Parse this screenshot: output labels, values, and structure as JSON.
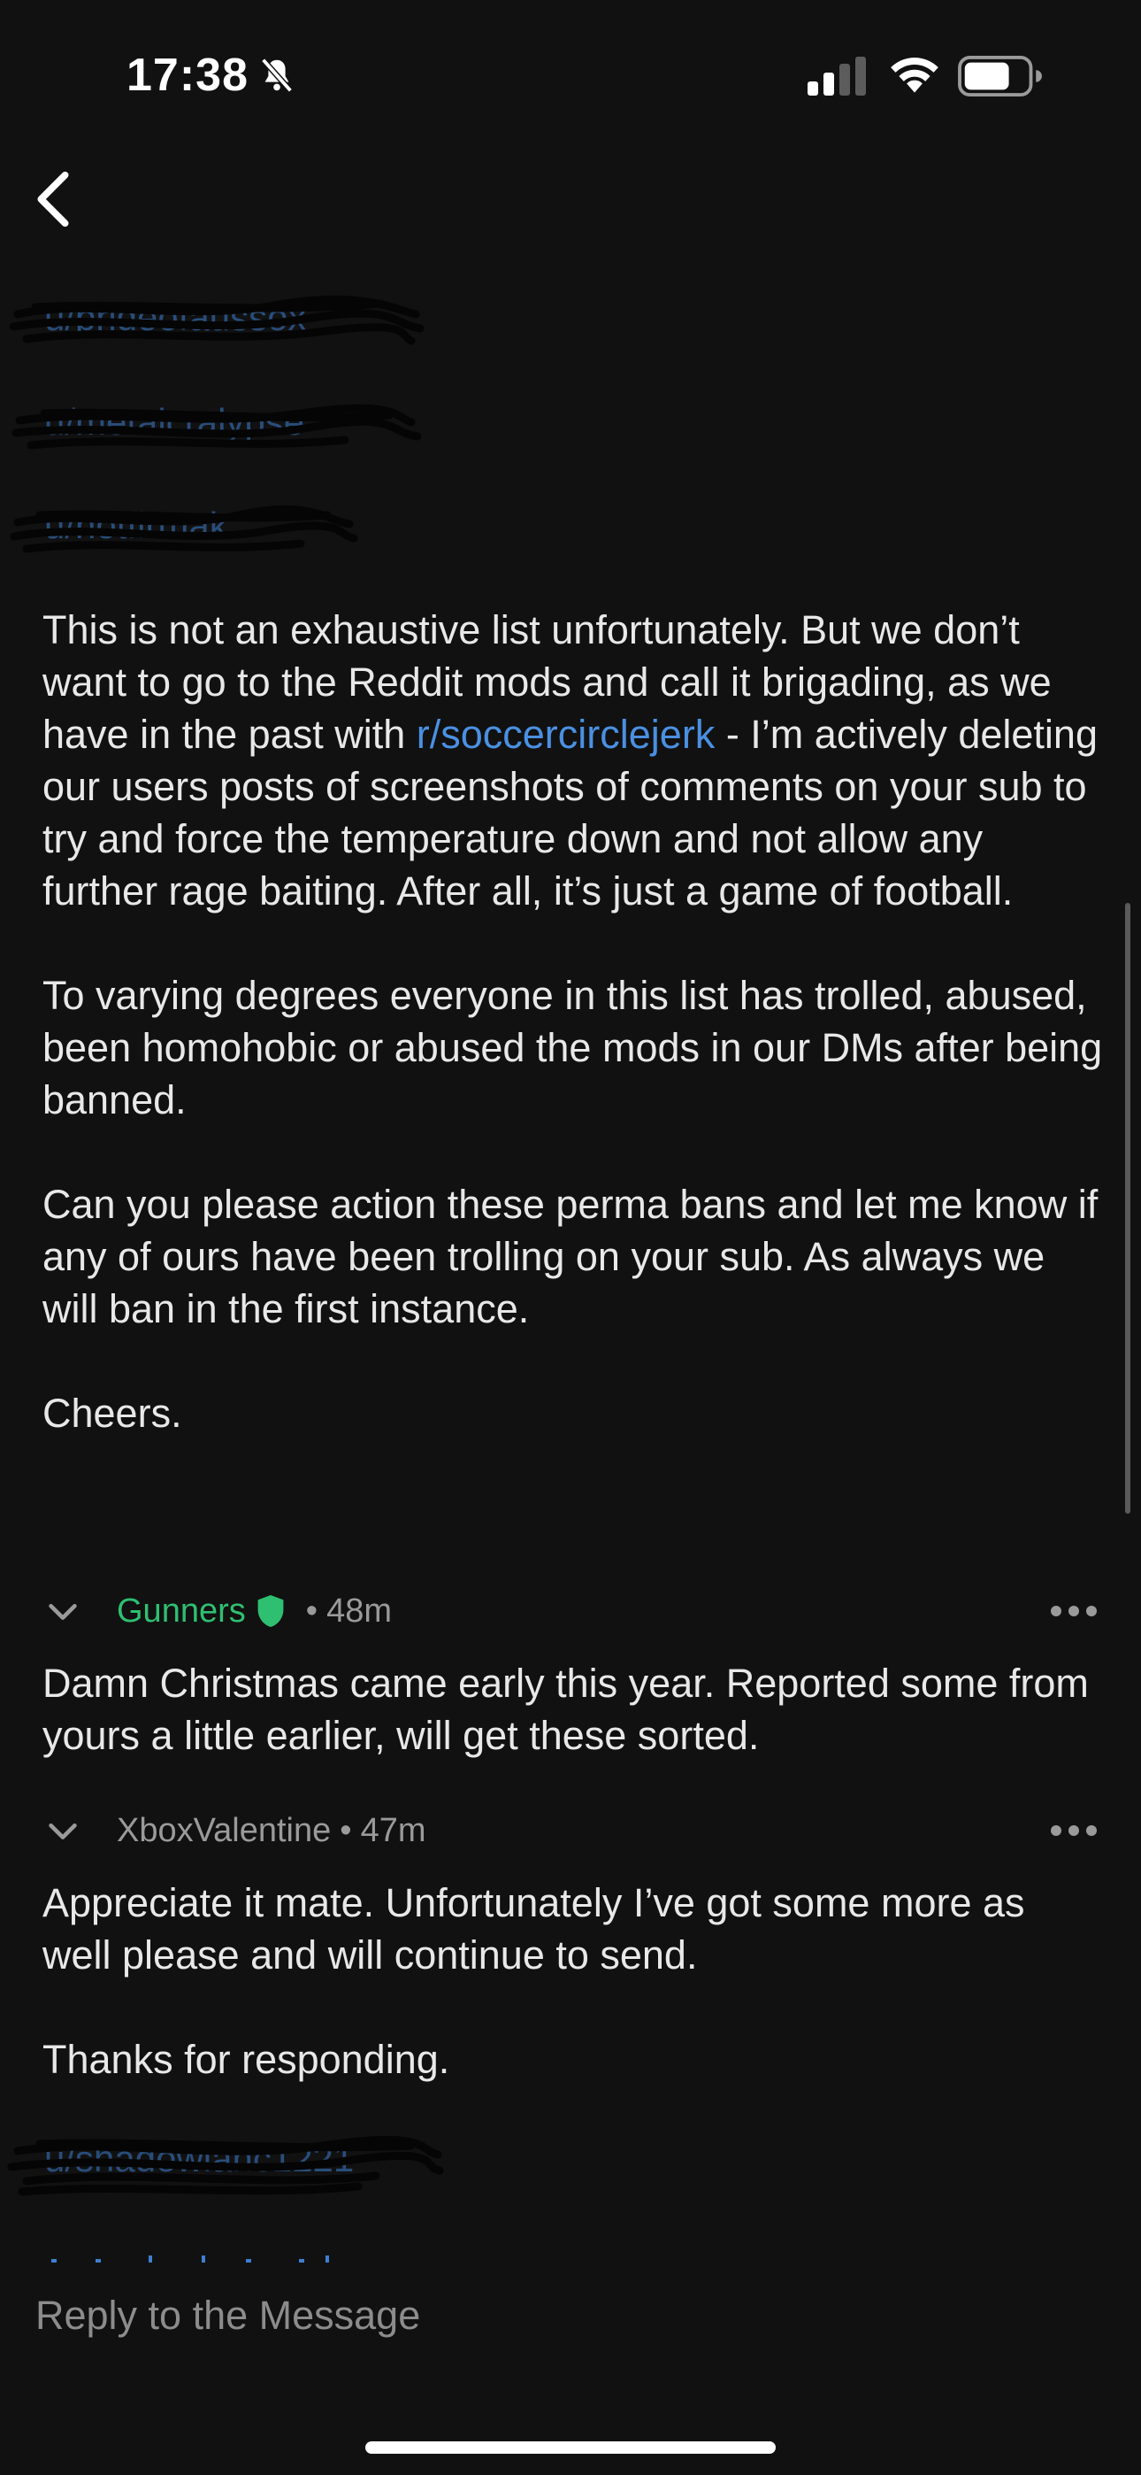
{
  "status_bar": {
    "time": "17:38"
  },
  "redacted_links": [
    {
      "text": "u/prideofaussox"
    },
    {
      "text": "u/metalcralypse"
    },
    {
      "text": "u/notfirmak"
    },
    {
      "text": "u/shadowlanc1221"
    }
  ],
  "message": {
    "paragraphs": [
      {
        "before": "This is not an exhaustive list unfortunately. But we don’t want to go to the Reddit mods and call it brigading, as we have in the past with ",
        "link": "r/soccercirclejerk",
        "after": " - I’m actively deleting our users posts of screenshots of comments on your sub to try and force the temperature down and not allow any further rage baiting. After all, it’s just a game of football."
      },
      {
        "text": "To varying degrees everyone in this list has trolled, abused, been homohobic or abused the mods in our DMs after being banned."
      },
      {
        "text": "Can you please action these perma bans and let me know if any of ours have been trolling on your sub. As always we will ban in the first instance."
      },
      {
        "text": "Cheers."
      }
    ]
  },
  "comments": [
    {
      "author": "Gunners",
      "is_mod": true,
      "age": "48m",
      "body": [
        "Damn Christmas came early this year. Reported some from yours a little earlier, will get these sorted."
      ]
    },
    {
      "author": "XboxValentine",
      "is_mod": false,
      "age": "47m",
      "body": [
        "Appreciate it mate. Unfortunately I’ve got some more as well please and will continue to send.",
        "Thanks for responding."
      ]
    }
  ],
  "reply": {
    "placeholder": "Reply to the Message"
  },
  "colors": {
    "link": "#4a90e2",
    "mod_green": "#2fbf71",
    "background": "#111111"
  }
}
